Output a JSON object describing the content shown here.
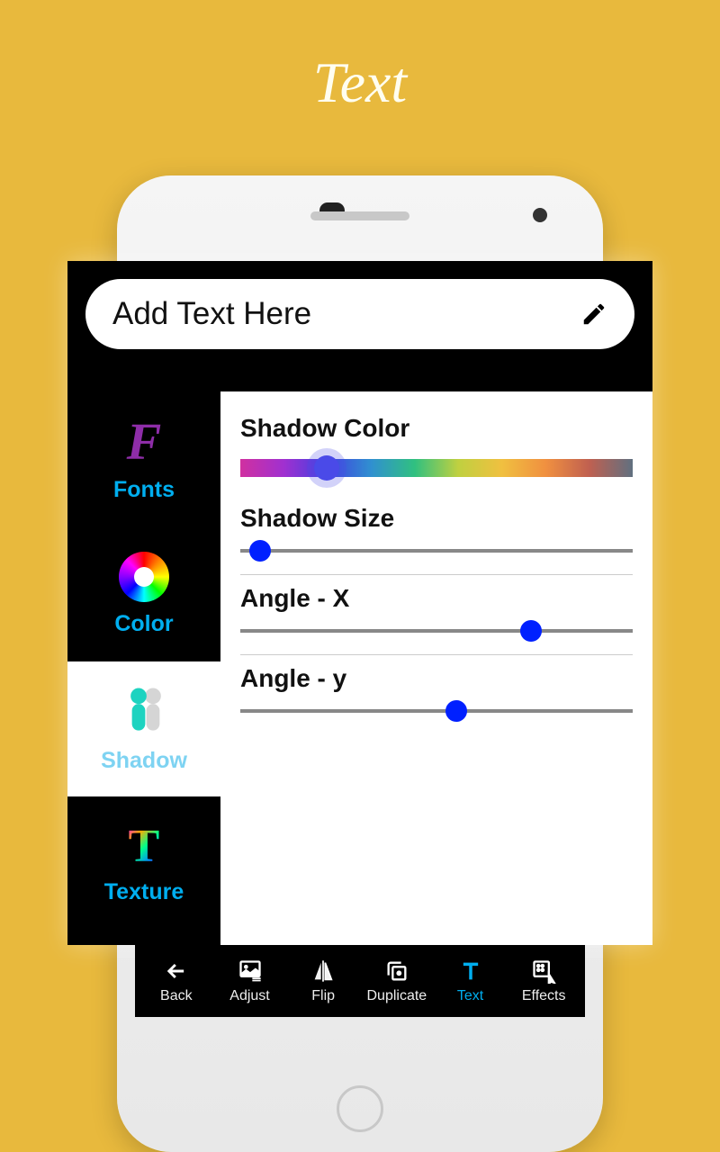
{
  "page_title": "Text",
  "input": {
    "placeholder": "Add Text Here"
  },
  "sidebar": {
    "items": [
      {
        "label": "Fonts"
      },
      {
        "label": "Color"
      },
      {
        "label": "Shadow"
      },
      {
        "label": "Texture"
      }
    ]
  },
  "controls": {
    "shadow_color": {
      "label": "Shadow Color",
      "value_pct": 22
    },
    "shadow_size": {
      "label": "Shadow Size",
      "value_pct": 5
    },
    "angle_x": {
      "label": "Angle - X",
      "value_pct": 74
    },
    "angle_y": {
      "label": "Angle - y",
      "value_pct": 55
    }
  },
  "bottom_bar": {
    "items": [
      {
        "label": "Back"
      },
      {
        "label": "Adjust"
      },
      {
        "label": "Flip"
      },
      {
        "label": "Duplicate"
      },
      {
        "label": "Text"
      },
      {
        "label": "Effects"
      }
    ]
  }
}
